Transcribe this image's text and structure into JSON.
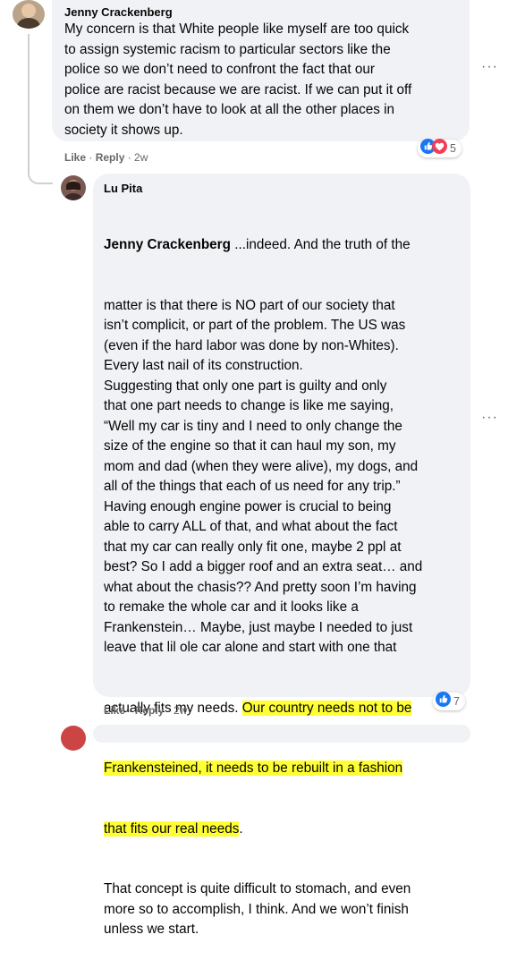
{
  "comments": [
    {
      "author": "Jenny Crackenberg",
      "lines": [
        "My concern is that White people like myself are too quick",
        "to assign systemic racism to particular sectors like the",
        "police so we don’t need to confront the fact that our",
        "police are racist because we are racist. If we can put it off",
        "on them we don’t have to look at all the other places in",
        "society it shows up."
      ],
      "actions": {
        "like": "Like",
        "reply": "Reply",
        "time": "2w"
      },
      "reaction_count": "5",
      "reaction_icons": [
        "like-icon",
        "love-icon"
      ]
    },
    {
      "author": "Lu Pita",
      "mention": "Jenny Crackenberg",
      "line1_rest": " ...indeed. And the truth of the",
      "lines": [
        "matter is that there is NO part of our society that",
        "isn’t complicit, or part of the problem. The US was",
        "(even if the hard labor was done by non-Whites).",
        "Every last nail of its construction.",
        "Suggesting that only one part is guilty and only",
        "that one part needs to change is like me saying,",
        "“Well my car is tiny and I need to only change the",
        "size of the engine so that it can haul my son, my",
        "mom and dad (when they were alive), my dogs, and",
        "all of the things that each of us need for any trip.”",
        "Having enough engine power is crucial to being",
        "able to carry ALL of that, and what about the fact",
        "that my car can really only fit one, maybe 2 ppl at",
        "best? So I add a bigger roof and an extra seat… and",
        "what about the chasis?? And pretty soon I’m having",
        "to remake the whole car and it looks like a",
        "Frankenstein… Maybe, just maybe I needed to just",
        "leave that lil ole car alone and start with one that"
      ],
      "hl_line_pre": "actually fits my needs. ",
      "hl_line_hl": "Our country needs not to be",
      "hl_line2": "Frankensteined, it needs to be rebuilt in a fashion",
      "hl_line3_hl": "that fits our real needs",
      "hl_line3_post": ".",
      "tail_lines": [
        "That concept is quite difficult to stomach, and even",
        "more so to accomplish, I think. And we won’t finish",
        "unless we start."
      ],
      "actions": {
        "like": "Like",
        "reply": "Reply",
        "time": "2w"
      },
      "reaction_count": "7",
      "reaction_icons": [
        "like-icon"
      ]
    }
  ],
  "more_options": "···",
  "colors": {
    "like_blue": "#1877f2",
    "love_red": "#f33e58",
    "highlight": "#ffff33",
    "bubble": "#f0f2f5"
  }
}
